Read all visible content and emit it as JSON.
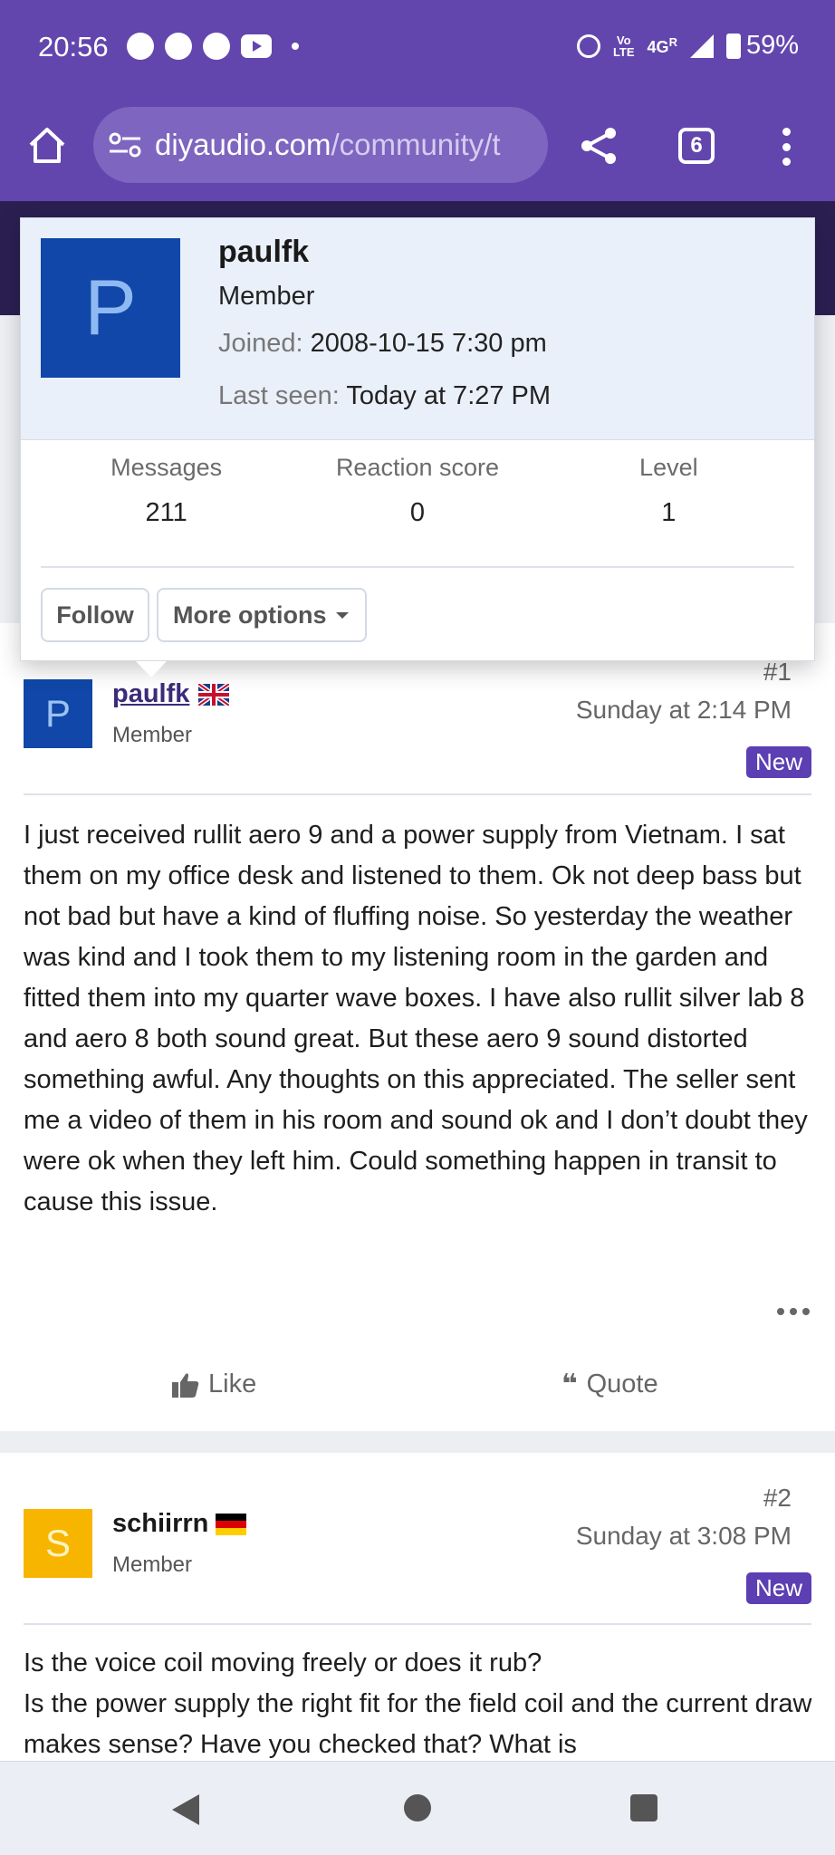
{
  "status_bar": {
    "time": "20:56",
    "net_lte_top": "Vo",
    "net_lte_bottom": "LTE",
    "network": "4G",
    "roaming": "R",
    "battery": "59%",
    "icons": [
      "chat-icon",
      "chat-icon",
      "chat-icon",
      "youtube-icon",
      "alarm-icon",
      "signal-icon",
      "battery-icon"
    ]
  },
  "browser": {
    "url_domain": "diyaudio.com",
    "url_path": "/community/t",
    "tab_count": "6"
  },
  "member_card": {
    "avatar_letter": "P",
    "name": "paulfk",
    "role": "Member",
    "joined_label": "Joined:",
    "joined_value": "2008-10-15 7:30 pm",
    "last_seen_label": "Last seen:",
    "last_seen_value": "Today at 7:27 PM",
    "stats": [
      {
        "label": "Messages",
        "value": "211"
      },
      {
        "label": "Reaction score",
        "value": "0"
      },
      {
        "label": "Level",
        "value": "1"
      }
    ],
    "follow_label": "Follow",
    "more_options_label": "More options"
  },
  "posts": [
    {
      "avatar_letter": "P",
      "author": "paulfk",
      "flag": "uk-flag",
      "role": "Member",
      "number": "#1",
      "date": "Sunday at 2:14 PM",
      "badge": "New",
      "body": "I just received rullit aero 9 and a power supply from Vietnam. I sat them on my office desk and listened to them. Ok not deep bass but not bad but have a kind of fluffing noise. So yesterday the weather was kind and I took them to my listening room in the garden and fitted them into my quarter wave boxes. I have also rullit silver lab 8 and aero 8 both sound great. But these aero 9 sound distorted something awful. Any thoughts on this appreciated. The seller sent me a video of them in his room and sound ok and I don’t doubt they were ok when they left him. Could something happen in transit to cause this issue.",
      "like_label": "Like",
      "quote_label": "Quote"
    },
    {
      "avatar_letter": "S",
      "author": "schiirrn",
      "flag": "de-flag",
      "role": "Member",
      "number": "#2",
      "date": "Sunday at 3:08 PM",
      "badge": "New",
      "body_line1": "Is the voice coil moving freely or does it rub?",
      "body_line2": "Is the power supply the right fit for the field coil and the current draw makes sense? Have you checked that? What is"
    }
  ],
  "colors": {
    "brand_purple": "#6346ad",
    "badge_purple": "#5b3fb3",
    "avatar_blue": "#1047a8",
    "avatar_yellow": "#f7b500"
  }
}
